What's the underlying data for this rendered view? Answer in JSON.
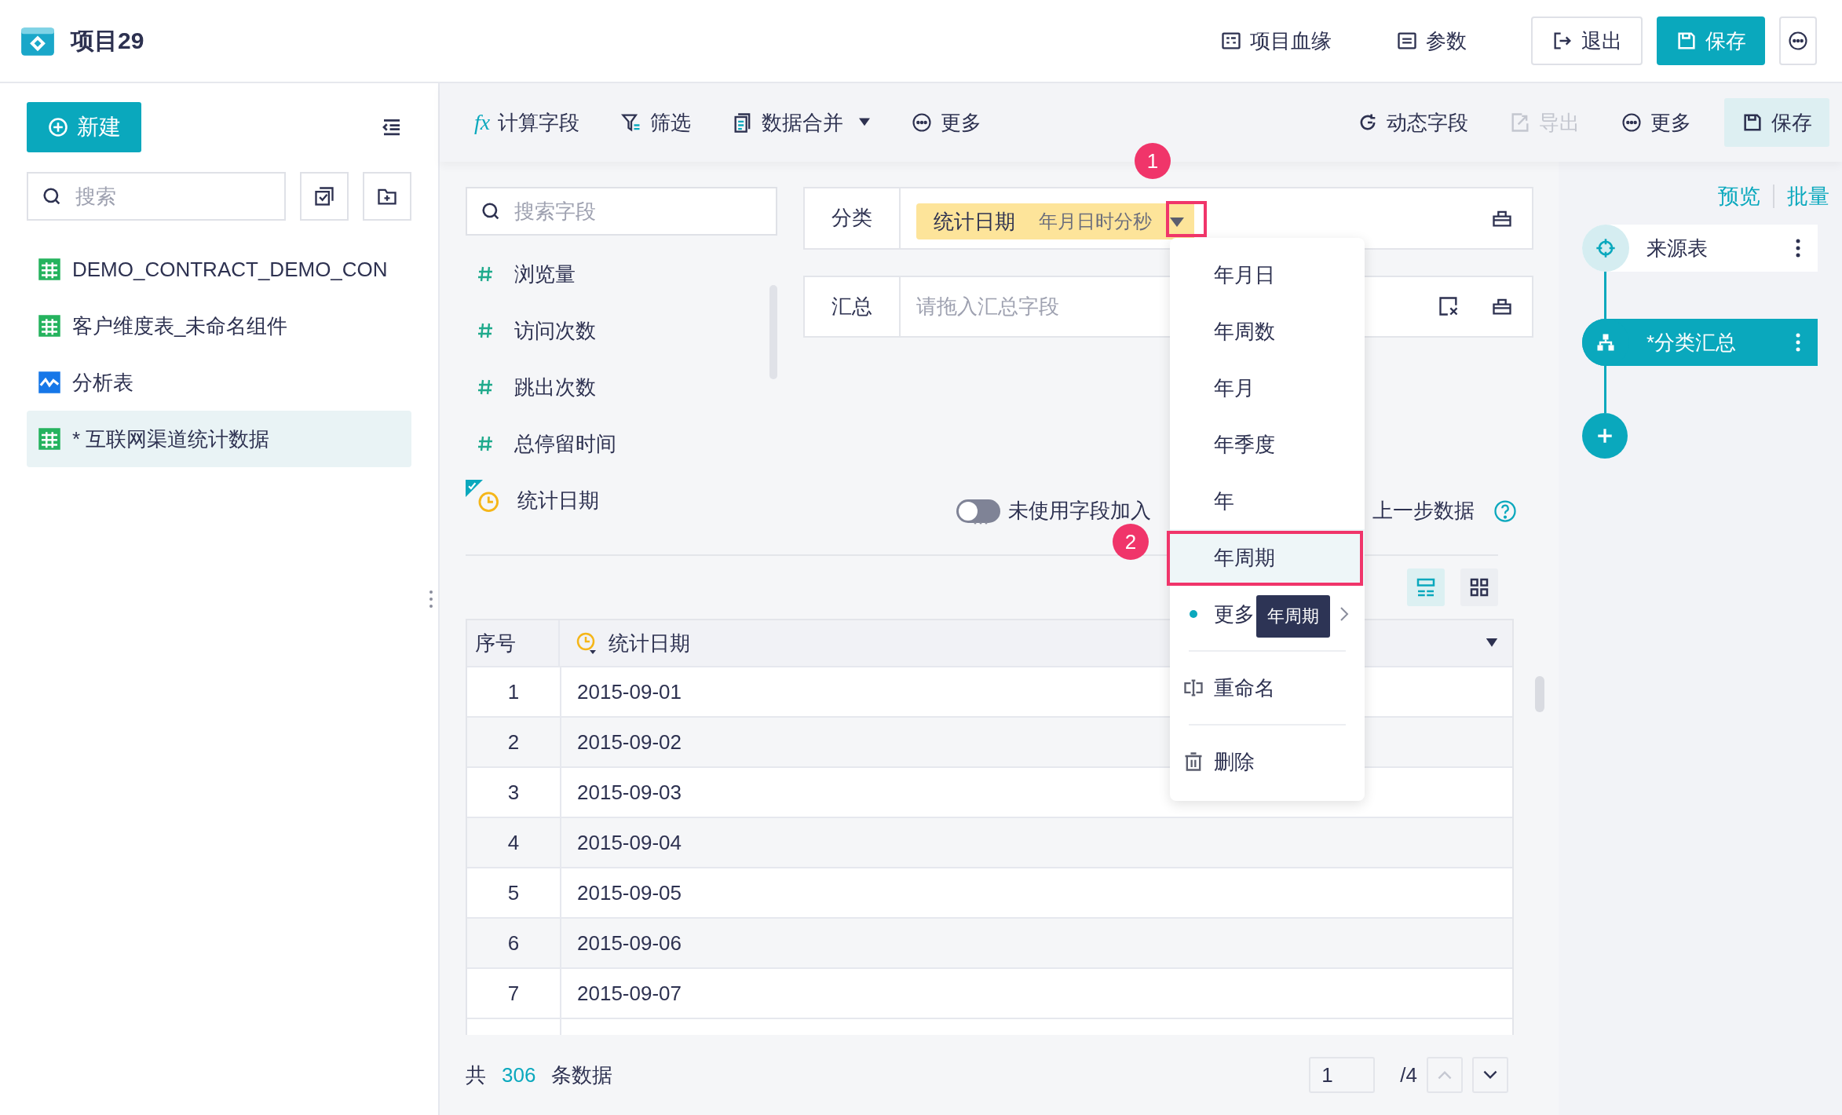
{
  "app": {
    "title": "项目29"
  },
  "header_actions": [
    {
      "label": "项目血缘",
      "kind": "link"
    },
    {
      "label": "参数",
      "kind": "link"
    },
    {
      "label": "退出",
      "kind": "outline"
    },
    {
      "label": "保存",
      "kind": "primary"
    }
  ],
  "sidebar": {
    "new_button": "新建",
    "search": {
      "placeholder": "搜索"
    },
    "items": [
      {
        "label": "DEMO_CONTRACT_DEMO_CON",
        "kind": "table",
        "selected": false
      },
      {
        "label": "客户维度表_未命名组件",
        "kind": "table",
        "selected": false
      },
      {
        "label": "分析表",
        "kind": "analysis",
        "selected": false
      },
      {
        "label": "* 互联网渠道统计数据",
        "kind": "table",
        "selected": true
      }
    ]
  },
  "toolbar": {
    "left": [
      {
        "label": "计算字段",
        "dropdown": false,
        "symbol": "fx"
      },
      {
        "label": "筛选",
        "dropdown": false
      },
      {
        "label": "数据合并",
        "dropdown": true
      },
      {
        "label": "更多",
        "dropdown": false
      }
    ],
    "right": [
      {
        "label": "动态字段",
        "kind": "plain",
        "disabled": false
      },
      {
        "label": "导出",
        "kind": "plain",
        "disabled": true
      },
      {
        "label": "更多",
        "kind": "plain",
        "disabled": false
      },
      {
        "label": "保存",
        "kind": "tinted",
        "disabled": false
      }
    ]
  },
  "fields": {
    "search": {
      "placeholder": "搜索字段"
    },
    "items": [
      {
        "name": "浏览量",
        "kind": "number",
        "in_use": false
      },
      {
        "name": "访问次数",
        "kind": "number",
        "in_use": false
      },
      {
        "name": "跳出次数",
        "kind": "number",
        "in_use": false
      },
      {
        "name": "总停留时间",
        "kind": "number",
        "in_use": false
      },
      {
        "name": "统计日期",
        "kind": "date",
        "in_use": true
      }
    ]
  },
  "config": {
    "group": {
      "label": "分类",
      "chip": {
        "name": "统计日期",
        "granularity": "年月日时分秒"
      }
    },
    "summary": {
      "label": "汇总",
      "placeholder": "请拖入汇总字段"
    },
    "toggle": {
      "on": false,
      "label_start": "未使用字段加入",
      "label_end": "上一步数据"
    }
  },
  "table": {
    "columns": [
      "序号",
      "统计日期"
    ],
    "rows": [
      [
        "1",
        "2015-09-01"
      ],
      [
        "2",
        "2015-09-02"
      ],
      [
        "3",
        "2015-09-03"
      ],
      [
        "4",
        "2015-09-04"
      ],
      [
        "5",
        "2015-09-05"
      ],
      [
        "6",
        "2015-09-06"
      ],
      [
        "7",
        "2015-09-07"
      ]
    ]
  },
  "footer": {
    "prefix": "共",
    "count": "306",
    "suffix": "条数据",
    "page": "1",
    "total": "/4"
  },
  "flow": {
    "links": [
      "预览",
      "批量"
    ],
    "nodes": [
      {
        "label": "来源表",
        "kind": "source",
        "selected": false
      },
      {
        "label": "*分类汇总",
        "kind": "group",
        "selected": true
      }
    ]
  },
  "dropdown": {
    "tooltip": "年周期",
    "items": [
      {
        "label": "年月日",
        "kind": "option",
        "selected": false
      },
      {
        "label": "年周数",
        "kind": "option",
        "selected": false
      },
      {
        "label": "年月",
        "kind": "option",
        "selected": false
      },
      {
        "label": "年季度",
        "kind": "option",
        "selected": false
      },
      {
        "label": "年",
        "kind": "option",
        "selected": false
      },
      {
        "label": "年周期",
        "kind": "option",
        "selected": true
      },
      {
        "label": "更多",
        "kind": "submenu",
        "selected": false
      },
      {
        "label": "重命名",
        "kind": "rename",
        "selected": false
      },
      {
        "label": "删除",
        "kind": "delete",
        "selected": false
      }
    ]
  },
  "annotations": [
    {
      "label": "1"
    },
    {
      "label": "2"
    }
  ]
}
